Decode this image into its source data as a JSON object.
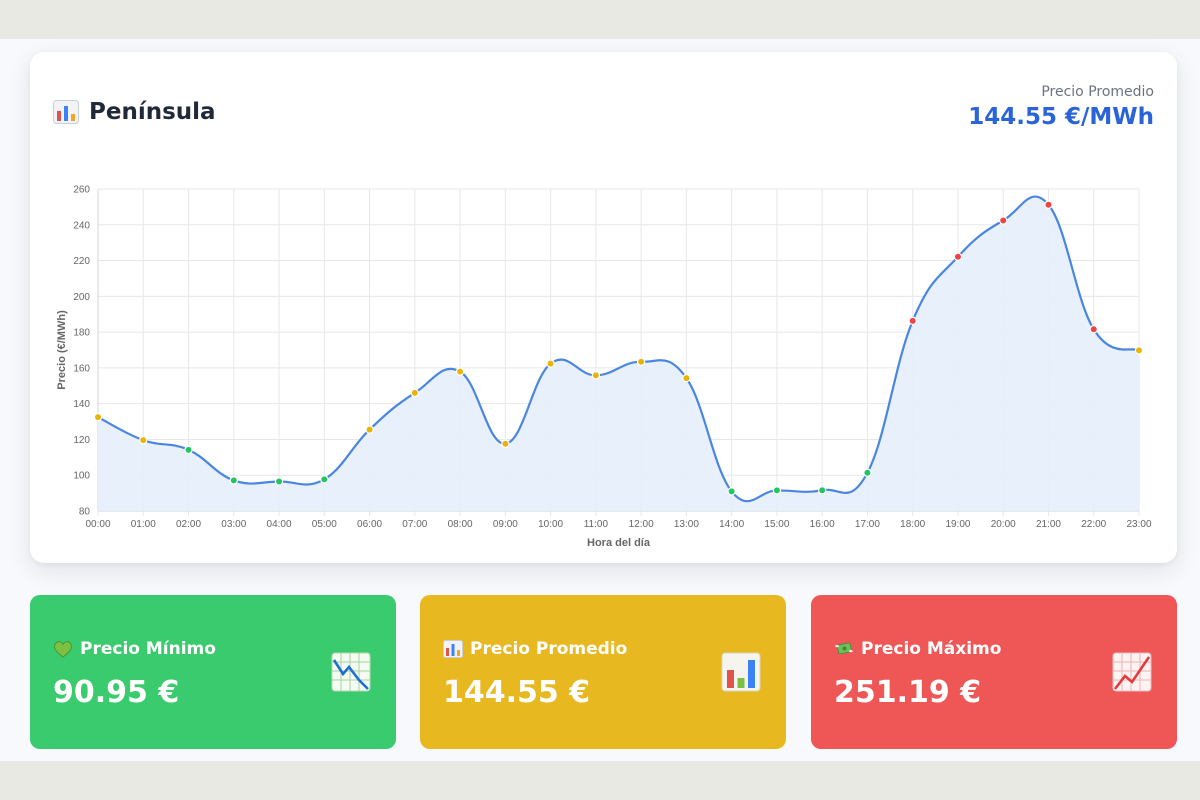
{
  "header": {
    "title": "Península",
    "avg_label": "Precio Promedio",
    "avg_value": "144.55 €/MWh"
  },
  "chart_data": {
    "type": "line",
    "categories": [
      "00:00",
      "01:00",
      "02:00",
      "03:00",
      "04:00",
      "05:00",
      "06:00",
      "07:00",
      "08:00",
      "09:00",
      "10:00",
      "11:00",
      "12:00",
      "13:00",
      "14:00",
      "15:00",
      "16:00",
      "17:00",
      "18:00",
      "19:00",
      "20:00",
      "21:00",
      "22:00",
      "23:00"
    ],
    "series": [
      {
        "values": [
          132.5,
          119.6,
          114.2,
          97.1,
          96.5,
          97.7,
          125.5,
          146.0,
          157.9,
          117.6,
          162.4,
          155.8,
          163.4,
          154.3,
          90.95,
          91.5,
          91.6,
          101.4,
          186.3,
          222.1,
          242.4,
          251.19,
          181.6,
          169.8
        ]
      }
    ],
    "point_colors": [
      "#eab308",
      "#eab308",
      "#22c55e",
      "#22c55e",
      "#22c55e",
      "#22c55e",
      "#eab308",
      "#eab308",
      "#eab308",
      "#eab308",
      "#eab308",
      "#eab308",
      "#eab308",
      "#eab308",
      "#22c55e",
      "#22c55e",
      "#22c55e",
      "#22c55e",
      "#ef4444",
      "#ef4444",
      "#ef4444",
      "#ef4444",
      "#ef4444",
      "#eab308"
    ],
    "xlabel": "Hora del día",
    "ylabel": "Precio (€/MWh)",
    "ylim": [
      80,
      260
    ],
    "yticks": [
      80,
      100,
      120,
      140,
      160,
      180,
      200,
      220,
      240,
      260
    ],
    "grid": true,
    "line_color": "#4a86e0",
    "fill_color": "#e6eefb"
  },
  "stats": {
    "min": {
      "label": "Precio Mínimo",
      "value": "90.95 €",
      "emoji": "green-heart-icon",
      "icon": "chart-decreasing-icon",
      "color": "#3acb6e"
    },
    "avg": {
      "label": "Precio Promedio",
      "value": "144.55 €",
      "emoji": "bar-chart-icon",
      "icon": "bar-chart-icon",
      "color": "#e8b820"
    },
    "max": {
      "label": "Precio Máximo",
      "value": "251.19 €",
      "emoji": "money-wings-icon",
      "icon": "chart-increasing-icon",
      "color": "#ef5656"
    }
  }
}
